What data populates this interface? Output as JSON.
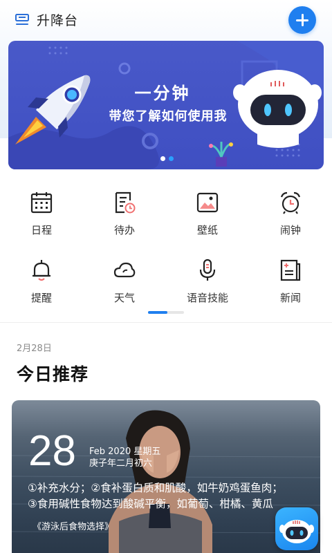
{
  "header": {
    "title": "升降台",
    "menu_icon": "menu-icon",
    "add_icon": "plus-icon",
    "accent": "#1f7fef"
  },
  "banner": {
    "title": "一分钟",
    "subtitle": "带您了解如何使用我",
    "slide_count": 2,
    "active_slide": 2,
    "background": "#4456c6"
  },
  "shortcuts": [
    {
      "label": "日程",
      "icon": "calendar-icon"
    },
    {
      "label": "待办",
      "icon": "todo-list-icon"
    },
    {
      "label": "壁纸",
      "icon": "wallpaper-icon"
    },
    {
      "label": "闹钟",
      "icon": "alarm-clock-icon"
    },
    {
      "label": "提醒",
      "icon": "bell-icon"
    },
    {
      "label": "天气",
      "icon": "cloud-icon"
    },
    {
      "label": "语音技能",
      "icon": "microphone-icon"
    },
    {
      "label": "新闻",
      "icon": "news-icon"
    }
  ],
  "shortcut_pager": {
    "page": 1,
    "pages": 2
  },
  "recommendation": {
    "date": "2月28日",
    "title": "今日推荐",
    "card": {
      "day": "28",
      "month_year_weekday": "Feb 2020 星期五",
      "lunar_date": "庚子年二月初六",
      "tip_line_1": "①补充水分；②食补蛋白质和肌酸，如牛奶鸡蛋鱼肉；",
      "tip_line_2": "③食用碱性食物达到酸碱平衡，如葡萄、柑橘、黄瓜",
      "source": "《游泳后食物选择》"
    }
  },
  "assistant_button": {
    "icon": "robot-assistant-icon"
  }
}
